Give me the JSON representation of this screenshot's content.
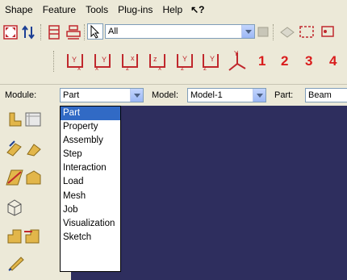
{
  "menubar": {
    "items": [
      "Shape",
      "Feature",
      "Tools",
      "Plug-ins",
      "Help"
    ],
    "whats_this": "↖?"
  },
  "toolbar": {
    "selection_filter": "All"
  },
  "view_numbers": [
    "1",
    "2",
    "3",
    "4"
  ],
  "context": {
    "module_label": "Module:",
    "module_value": "Part",
    "model_label": "Model:",
    "model_value": "Model-1",
    "part_label": "Part:",
    "part_value": "Beam"
  },
  "module_dropdown": {
    "options": [
      "Part",
      "Property",
      "Assembly",
      "Step",
      "Interaction",
      "Load",
      "Mesh",
      "Job",
      "Visualization",
      "Sketch"
    ],
    "selected": "Part"
  },
  "colors": {
    "viewport": "#2e2e5e",
    "selection": "#316ac5",
    "accent_red": "#d91c1c"
  }
}
